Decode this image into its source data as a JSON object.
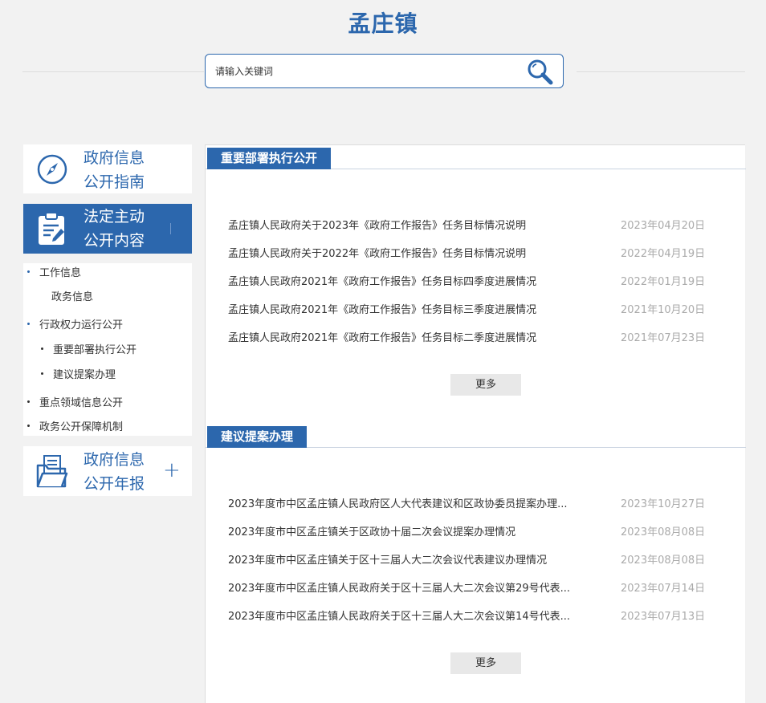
{
  "header": {
    "title": "孟庄镇",
    "search_placeholder": "请输入关键词"
  },
  "sidebar": {
    "guide": {
      "line1": "政府信息",
      "line2": "公开指南"
    },
    "content": {
      "line1": "法定主动",
      "line2": "公开内容"
    },
    "report": {
      "line1": "政府信息",
      "line2": "公开年报",
      "plus": "+"
    },
    "menu": [
      {
        "label": "工作信息"
      },
      {
        "label": "政务信息"
      },
      {
        "label": "行政权力运行公开"
      },
      {
        "label": "重要部署执行公开"
      },
      {
        "label": "建议提案办理"
      },
      {
        "label": "重点领域信息公开"
      },
      {
        "label": "政务公开保障机制"
      }
    ]
  },
  "sections": [
    {
      "heading": "重要部署执行公开",
      "more": "更多",
      "items": [
        {
          "title": "孟庄镇人民政府关于2023年《政府工作报告》任务目标情况说明",
          "date": "2023年04月20日"
        },
        {
          "title": "孟庄镇人民政府关于2022年《政府工作报告》任务目标情况说明",
          "date": "2022年04月19日"
        },
        {
          "title": "孟庄镇人民政府2021年《政府工作报告》任务目标四季度进展情况",
          "date": "2022年01月19日"
        },
        {
          "title": "孟庄镇人民政府2021年《政府工作报告》任务目标三季度进展情况",
          "date": "2021年10月20日"
        },
        {
          "title": "孟庄镇人民政府2021年《政府工作报告》任务目标二季度进展情况",
          "date": "2021年07月23日"
        }
      ]
    },
    {
      "heading": "建议提案办理",
      "more": "更多",
      "items": [
        {
          "title": "2023年度市中区孟庄镇人民政府区人大代表建议和区政协委员提案办理...",
          "date": "2023年10月27日"
        },
        {
          "title": "2023年度市中区孟庄镇关于区政协十届二次会议提案办理情况",
          "date": "2023年08月08日"
        },
        {
          "title": "2023年度市中区孟庄镇关于区十三届人大二次会议代表建议办理情况",
          "date": "2023年08月08日"
        },
        {
          "title": "2023年度市中区孟庄镇人民政府关于区十三届人大二次会议第29号代表...",
          "date": "2023年07月14日"
        },
        {
          "title": "2023年度市中区孟庄镇人民政府关于区十三届人大二次会议第14号代表...",
          "date": "2023年07月13日"
        }
      ]
    }
  ],
  "colors": {
    "brand": "#2c67ad",
    "date": "#aaaaaa",
    "more_bg": "#e8e8e8"
  }
}
